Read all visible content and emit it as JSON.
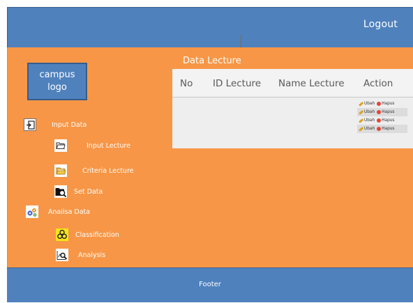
{
  "header": {
    "logout_label": "Logout"
  },
  "logo": {
    "line1": "campus",
    "line2": "logo"
  },
  "sidebar": {
    "items": [
      {
        "label": "Input Data",
        "icon": "input-arrow-icon"
      },
      {
        "label": "Input Lecture",
        "icon": "folder-icon"
      },
      {
        "label": "Criteria Lecture",
        "icon": "folder-open-icon"
      },
      {
        "label": "Set Data",
        "icon": "folder-search-icon"
      },
      {
        "label": "Analisa Data",
        "icon": "gears-icon"
      },
      {
        "label": "Classification",
        "icon": "biohazard-icon"
      },
      {
        "label": "Analysis",
        "icon": "chart-search-icon"
      }
    ]
  },
  "main": {
    "title": "Data Lecture",
    "table": {
      "columns": [
        "No",
        "ID Lecture",
        "Name Lecture",
        "Action"
      ],
      "rows": [
        {
          "edit": "Ubah",
          "delete": "Hapus"
        },
        {
          "edit": "Ubah",
          "delete": "Hapus"
        },
        {
          "edit": "Ubah",
          "delete": "Hapus"
        },
        {
          "edit": "Ubah",
          "delete": "Hapus"
        }
      ]
    }
  },
  "footer": {
    "label": "Footer"
  },
  "colors": {
    "header_blue": "#4f81bd",
    "main_orange": "#f79646",
    "table_bg": "#eeeeee"
  }
}
